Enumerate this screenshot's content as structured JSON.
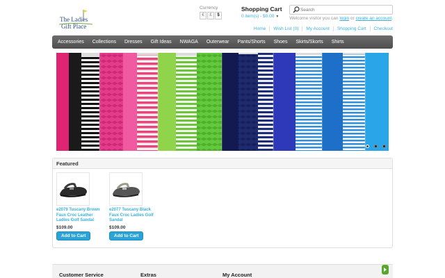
{
  "header": {
    "logo_text": [
      "The Ladies",
      "Gift Place"
    ],
    "currency": {
      "label": "Currency",
      "options": [
        "€",
        "£",
        "$"
      ],
      "selected": "$"
    },
    "cart": {
      "title": "Shopping Cart",
      "summary": "0 item(s) - $0.00"
    },
    "search": {
      "placeholder": "Search"
    },
    "welcome": {
      "prefix": "Welcome visitor you can",
      "login": "login",
      "middle": "or",
      "register": "create an account",
      "suffix": "."
    },
    "links": [
      "Home",
      "Wish List (0)",
      "My Account",
      "Shopping Cart",
      "Checkout"
    ]
  },
  "menu": {
    "items": [
      "Accessories",
      "Collections",
      "Dresses",
      "Gift Ideas",
      "NWAGA",
      "Outerwear",
      "Pants/Shorts",
      "Shoes",
      "Skirts/Skorts",
      "Shirts"
    ]
  },
  "banner": {
    "slide_count": 3,
    "active_slide": 0
  },
  "featured": {
    "title": "Featured",
    "products": [
      {
        "name": "e2079 Tuscany Brown Faux Croc Leather Ladies Golf Sandal",
        "price": "$109.00",
        "button": "Add to Cart"
      },
      {
        "name": "e2077 Tuscany Black Faux Croc Ladies Golf Sandal",
        "price": "$109.00",
        "button": "Add to Cart"
      }
    ]
  },
  "footer": {
    "columns": [
      "Customer Service",
      "Extras",
      "My Account"
    ]
  },
  "colors": {
    "link": "#38b0de",
    "menu_bg": "#5a5a5a",
    "button": "#2aa3d8",
    "scroll_top": "#58a82c"
  }
}
